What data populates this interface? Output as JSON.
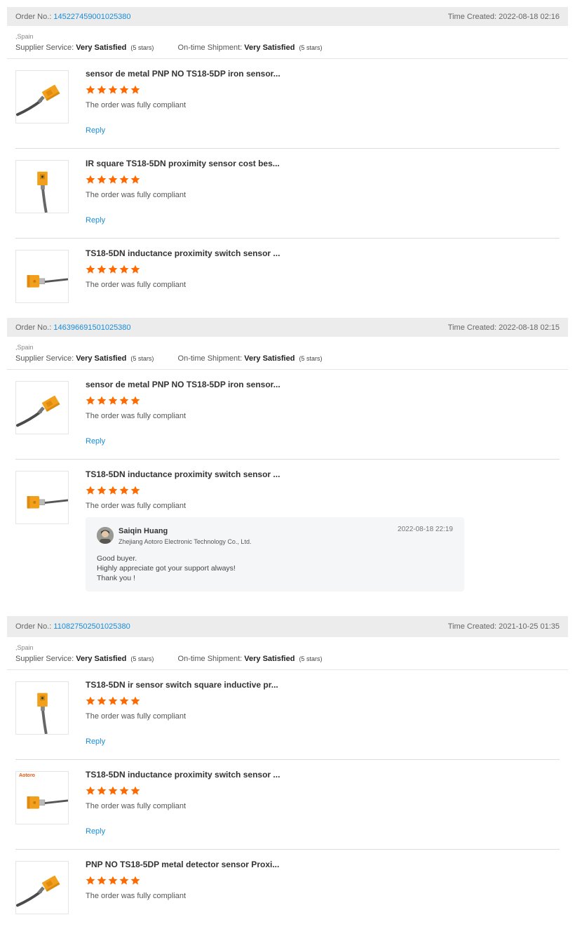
{
  "labels": {
    "order_no": "Order No.:",
    "time_created": "Time Created:",
    "supplier_service": "Supplier Service:",
    "on_time_shipment": "On-time Shipment:",
    "reply": "Reply"
  },
  "colors": {
    "star": "#ff6a00",
    "link": "#1a8cd8",
    "header_bg": "#ececec"
  },
  "orders": [
    {
      "number": "145227459001025380",
      "time": "2022-08-18 02:16",
      "country": ",Spain",
      "supplier_service": "Very Satisfied",
      "supplier_stars": "(5 stars)",
      "shipment": "Very Satisfied",
      "shipment_stars": "(5 stars)",
      "items": [
        {
          "title": "sensor de metal PNP NO TS18-5DP iron sensor...",
          "rating": 5,
          "comment": "The order was fully compliant",
          "thumb": "cable-sensor-icon"
        },
        {
          "title": "IR square TS18-5DN proximity sensor cost bes...",
          "rating": 5,
          "comment": "The order was fully compliant",
          "thumb": "vertical-sensor-icon"
        },
        {
          "title": "TS18-5DN inductance proximity switch sensor ...",
          "rating": 5,
          "comment": "The order was fully compliant",
          "thumb": "horizontal-sensor-icon"
        }
      ]
    },
    {
      "number": "146396691501025380",
      "time": "2022-08-18 02:15",
      "country": ",Spain",
      "supplier_service": "Very Satisfied",
      "supplier_stars": "(5 stars)",
      "shipment": "Very Satisfied",
      "shipment_stars": "(5 stars)",
      "items": [
        {
          "title": "sensor de metal PNP NO TS18-5DP iron sensor...",
          "rating": 5,
          "comment": "The order was fully compliant",
          "thumb": "cable-sensor-icon"
        },
        {
          "title": "TS18-5DN inductance proximity switch sensor ...",
          "rating": 5,
          "comment": "The order was fully compliant",
          "thumb": "horizontal-sensor-icon",
          "seller_reply": {
            "name": "Saiqin Huang",
            "company": "Zhejiang Aotoro Electronic Technology Co., Ltd.",
            "date": "2022-08-18 22:19",
            "text": "Good buyer.\nHighly appreciate got your support always!\nThank you !"
          }
        }
      ]
    },
    {
      "number": "110827502501025380",
      "time": "2021-10-25 01:35",
      "country": ",Spain",
      "supplier_service": "Very Satisfied",
      "supplier_stars": "(5 stars)",
      "shipment": "Very Satisfied",
      "shipment_stars": "(5 stars)",
      "items": [
        {
          "title": "TS18-5DN ir sensor switch square inductive pr...",
          "rating": 5,
          "comment": "The order was fully compliant",
          "thumb": "vertical-sensor-icon"
        },
        {
          "title": "TS18-5DN inductance proximity switch sensor ...",
          "rating": 5,
          "comment": "The order was fully compliant",
          "thumb": "horizontal-sensor-icon",
          "brand": "Aotoro"
        },
        {
          "title": "PNP NO TS18-5DP metal detector sensor Proxi...",
          "rating": 5,
          "comment": "The order was fully compliant",
          "thumb": "cable-sensor-icon"
        }
      ]
    }
  ]
}
